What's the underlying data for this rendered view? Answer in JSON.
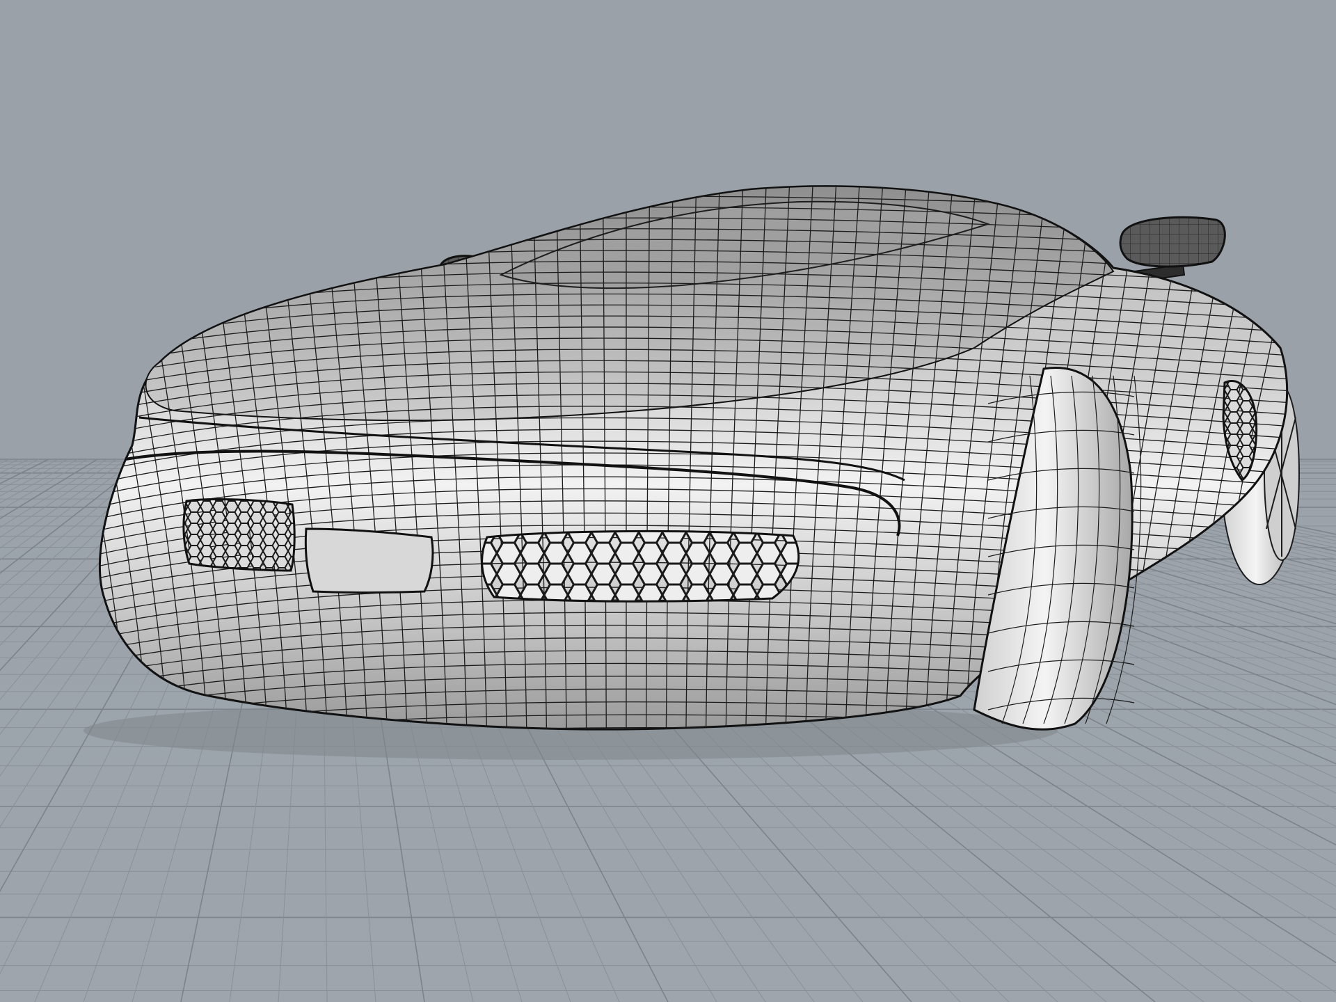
{
  "viewport": {
    "projection": "perspective",
    "display_mode": "shaded-wireframe",
    "background_color": "#9aa1a9",
    "grid_visible": true,
    "grid_color": "#8a9097",
    "grid_major_color": "#7c838a"
  },
  "model": {
    "kind": "concept sports car",
    "body_color": "#e4e4e4",
    "body_shadow_color": "#8e8e8e",
    "wire_color": "#1c1c1c",
    "wheel_color": "#d6d6d6",
    "grille_pattern": "hexagon-mesh",
    "visible_parts": [
      "front-fascia",
      "hood",
      "windshield",
      "left-mirror",
      "right-mirror",
      "front-right-wheel",
      "rear-right-wheel",
      "front-left-grille",
      "front-center-grille",
      "side-vent"
    ]
  }
}
